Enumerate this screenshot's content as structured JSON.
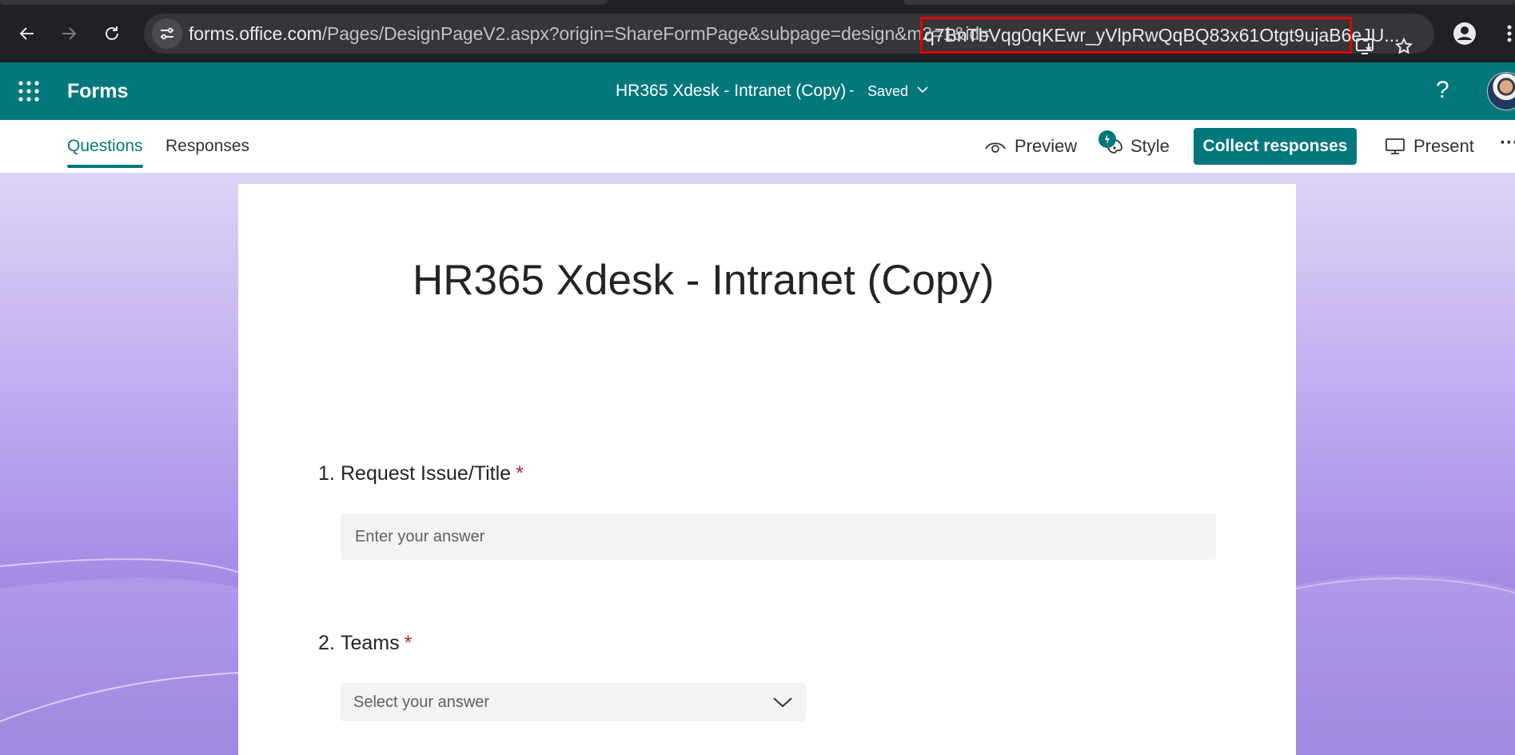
{
  "browser": {
    "url_host": "forms.office.com",
    "url_path": "/Pages/DesignPageV2.aspx?origin=ShareFormPage&subpage=design&m2=1&id=",
    "url_id": "q7BnTbVqg0qKEwr_yVlpRwQqBQ83x61Otgt9ujaB6eJU..."
  },
  "appbar": {
    "app_name": "Forms",
    "doc_title": "HR365 Xdesk - Intranet (Copy)",
    "separator": "-",
    "status": "Saved",
    "help": "?"
  },
  "toolbar": {
    "tabs": [
      {
        "label": "Questions",
        "active": true
      },
      {
        "label": "Responses",
        "active": false
      }
    ],
    "preview": "Preview",
    "style": "Style",
    "collect": "Collect responses",
    "present": "Present",
    "more": "···"
  },
  "form": {
    "title": "HR365 Xdesk - Intranet (Copy)",
    "questions": [
      {
        "number": "1.",
        "label": "Request Issue/Title",
        "required": "*",
        "placeholder": "Enter your answer"
      },
      {
        "number": "2.",
        "label": "Teams",
        "required": "*",
        "placeholder": "Select your answer"
      }
    ]
  },
  "colors": {
    "brand": "#03787c",
    "required": "#a4262c",
    "highlight": "#e00000"
  }
}
